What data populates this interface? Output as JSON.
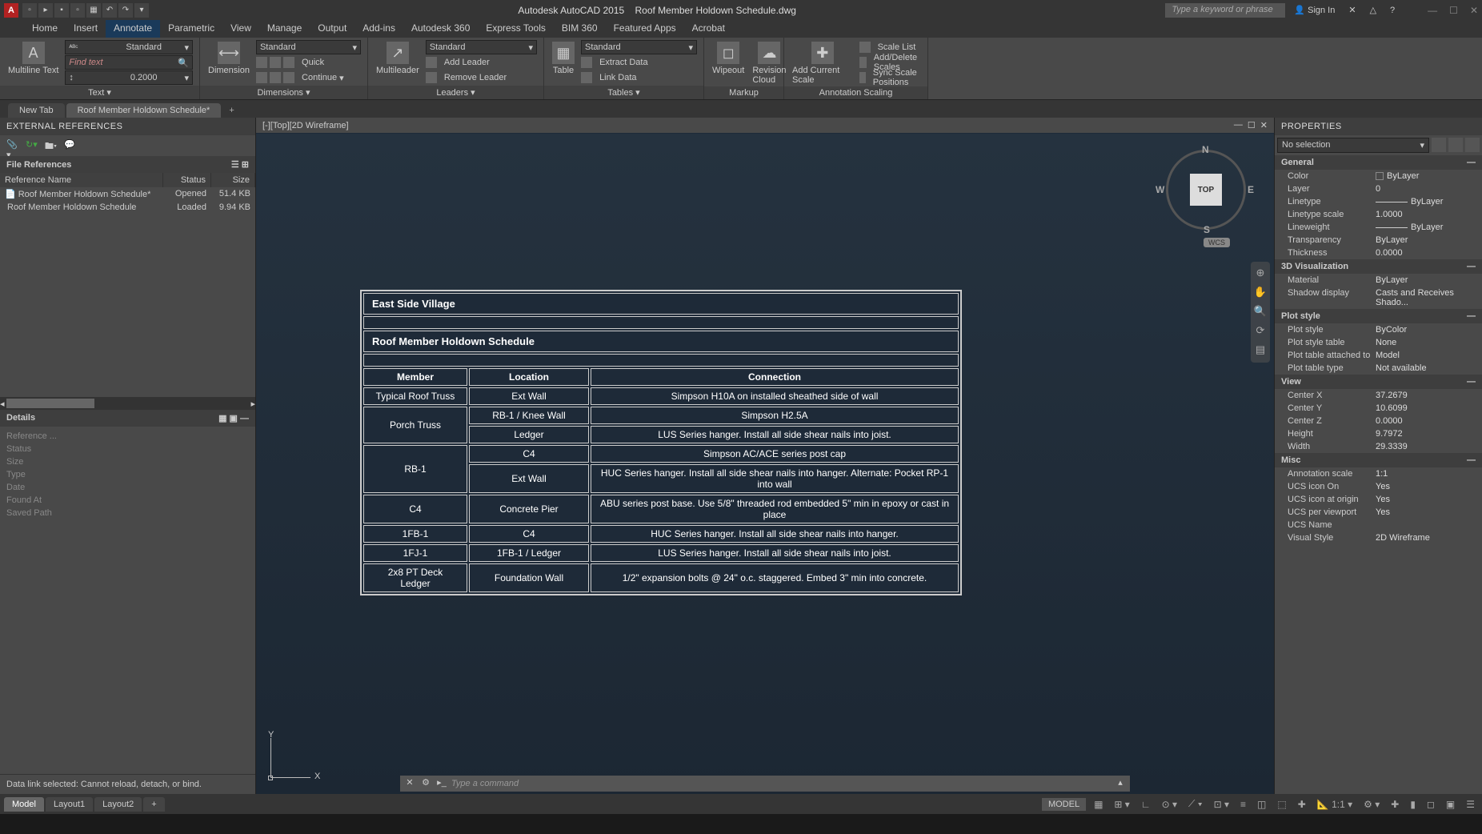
{
  "title": {
    "app": "Autodesk AutoCAD 2015",
    "doc": "Roof Member Holdown Schedule.dwg"
  },
  "search_placeholder": "Type a keyword or phrase",
  "signin_label": "Sign In",
  "menu": [
    "Home",
    "Insert",
    "Annotate",
    "Parametric",
    "View",
    "Manage",
    "Output",
    "Add-ins",
    "Autodesk 360",
    "Express Tools",
    "BIM 360",
    "Featured Apps",
    "Acrobat"
  ],
  "menu_active": "Annotate",
  "ribbon": {
    "text": {
      "label": "Text",
      "btn": "Multiline Text",
      "style": "Standard",
      "find_placeholder": "Find text",
      "height": "0.2000"
    },
    "dimensions": {
      "label": "Dimensions",
      "btn": "Dimension",
      "style": "Standard",
      "items": [
        "Quick",
        "Continue"
      ]
    },
    "leaders": {
      "label": "Leaders",
      "btn": "Multileader",
      "style": "Standard",
      "add": "Add Leader",
      "remove": "Remove Leader"
    },
    "tables": {
      "label": "Tables",
      "btn": "Table",
      "style": "Standard",
      "extract": "Extract Data",
      "link": "Link Data"
    },
    "markup": {
      "label": "Markup",
      "wipeout": "Wipeout",
      "revcloud": "Revision Cloud"
    },
    "scaling": {
      "label": "Annotation Scaling",
      "addscale": "Add Current Scale",
      "list": "Scale List",
      "adddel": "Add/Delete Scales",
      "sync": "Sync Scale Positions"
    }
  },
  "doc_tabs": {
    "new": "New Tab",
    "current": "Roof Member Holdown Schedule*"
  },
  "xref": {
    "title": "EXTERNAL REFERENCES",
    "section": "File References",
    "columns": [
      "Reference Name",
      "Status",
      "Size"
    ],
    "rows": [
      {
        "name": "Roof Member Holdown Schedule*",
        "status": "Opened",
        "size": "51.4 KB"
      },
      {
        "name": "Roof Member Holdown Schedule",
        "status": "Loaded",
        "size": "9.94 KB"
      }
    ],
    "details_title": "Details",
    "details_fields": [
      "Reference ...",
      "Status",
      "Size",
      "Type",
      "Date",
      "Found At",
      "Saved Path"
    ],
    "status_msg": "Data link selected: Cannot reload, detach, or bind."
  },
  "viewport_label": "[-][Top][2D Wireframe]",
  "viewcube": {
    "face": "TOP",
    "n": "N",
    "s": "S",
    "e": "E",
    "w": "W",
    "wcs": "WCS"
  },
  "coord": {
    "x": "X",
    "y": "Y"
  },
  "cmd_placeholder": "Type a command",
  "drawing": {
    "title1": "East Side Village",
    "title2": "Roof Member Holdown Schedule",
    "headers": [
      "Member",
      "Location",
      "Connection"
    ],
    "rows": [
      {
        "member": "Typical Roof Truss",
        "loc": "Ext Wall",
        "conn": "Simpson H10A on installed sheathed side of wall",
        "rowspan": 1
      },
      {
        "member": "Porch Truss",
        "loc": "RB-1 / Knee Wall",
        "conn": "Simpson H2.5A",
        "rowspan": 2
      },
      {
        "member": "",
        "loc": "Ledger",
        "conn": "LUS Series hanger. Install all side shear nails into joist."
      },
      {
        "member": "RB-1",
        "loc": "C4",
        "conn": "Simpson AC/ACE series post cap",
        "rowspan": 2
      },
      {
        "member": "",
        "loc": "Ext Wall",
        "conn": "HUC Series hanger. Install all side shear nails into hanger. Alternate: Pocket RP-1 into wall"
      },
      {
        "member": "C4",
        "loc": "Concrete Pier",
        "conn": "ABU series post base. Use 5/8\" threaded rod embedded 5\" min in epoxy or cast in place",
        "rowspan": 1
      },
      {
        "member": "1FB-1",
        "loc": "C4",
        "conn": "HUC Series hanger. Install all side shear nails into hanger.",
        "rowspan": 1
      },
      {
        "member": "1FJ-1",
        "loc": "1FB-1 / Ledger",
        "conn": "LUS Series hanger. Install all side shear nails into joist.",
        "rowspan": 1
      },
      {
        "member": "2x8 PT Deck Ledger",
        "loc": "Foundation Wall",
        "conn": "1/2\" expansion bolts @ 24\" o.c. staggered. Embed 3\" min into concrete.",
        "rowspan": 1
      }
    ]
  },
  "props": {
    "title": "PROPERTIES",
    "selection": "No selection",
    "sections": [
      {
        "name": "General",
        "rows": [
          {
            "k": "Color",
            "v": "ByLayer",
            "swatch": true
          },
          {
            "k": "Layer",
            "v": "0"
          },
          {
            "k": "Linetype",
            "v": "ByLayer",
            "line": true
          },
          {
            "k": "Linetype scale",
            "v": "1.0000"
          },
          {
            "k": "Lineweight",
            "v": "ByLayer",
            "line": true
          },
          {
            "k": "Transparency",
            "v": "ByLayer"
          },
          {
            "k": "Thickness",
            "v": "0.0000"
          }
        ]
      },
      {
        "name": "3D Visualization",
        "rows": [
          {
            "k": "Material",
            "v": "ByLayer"
          },
          {
            "k": "Shadow display",
            "v": "Casts and Receives Shado..."
          }
        ]
      },
      {
        "name": "Plot style",
        "rows": [
          {
            "k": "Plot style",
            "v": "ByColor"
          },
          {
            "k": "Plot style table",
            "v": "None"
          },
          {
            "k": "Plot table attached to",
            "v": "Model"
          },
          {
            "k": "Plot table type",
            "v": "Not available"
          }
        ]
      },
      {
        "name": "View",
        "rows": [
          {
            "k": "Center X",
            "v": "37.2679"
          },
          {
            "k": "Center Y",
            "v": "10.6099"
          },
          {
            "k": "Center Z",
            "v": "0.0000"
          },
          {
            "k": "Height",
            "v": "9.7972"
          },
          {
            "k": "Width",
            "v": "29.3339"
          }
        ]
      },
      {
        "name": "Misc",
        "rows": [
          {
            "k": "Annotation scale",
            "v": "1:1"
          },
          {
            "k": "UCS icon On",
            "v": "Yes"
          },
          {
            "k": "UCS icon at origin",
            "v": "Yes"
          },
          {
            "k": "UCS per viewport",
            "v": "Yes"
          },
          {
            "k": "UCS Name",
            "v": ""
          },
          {
            "k": "Visual Style",
            "v": "2D Wireframe"
          }
        ]
      }
    ]
  },
  "layout_tabs": [
    "Model",
    "Layout1",
    "Layout2"
  ],
  "model_badge": "MODEL",
  "scale_label": "1:1"
}
